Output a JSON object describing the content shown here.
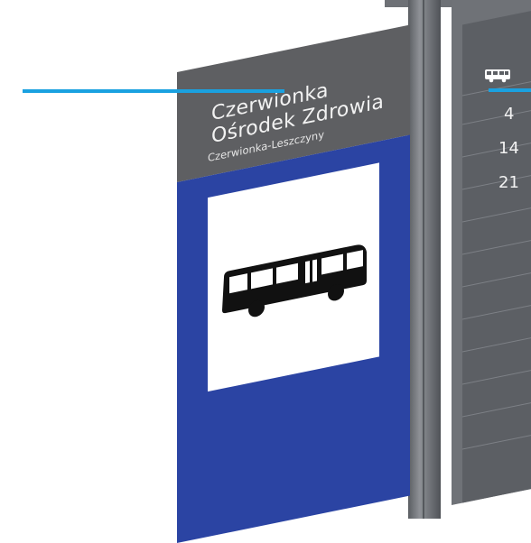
{
  "sign": {
    "stop_name_line1": "Czerwionka",
    "stop_name_line2": "Ośrodek Zdrowia",
    "locality": "Czerwionka-Leszczyny",
    "header_color": "#5e5f62",
    "body_color": "#2b44a3",
    "pictogram": "bus-icon"
  },
  "timetable": {
    "header_icon": "bus-icon",
    "routes": [
      "4",
      "14",
      "21"
    ]
  },
  "annotation": {
    "line_color": "#1aa1e0"
  }
}
